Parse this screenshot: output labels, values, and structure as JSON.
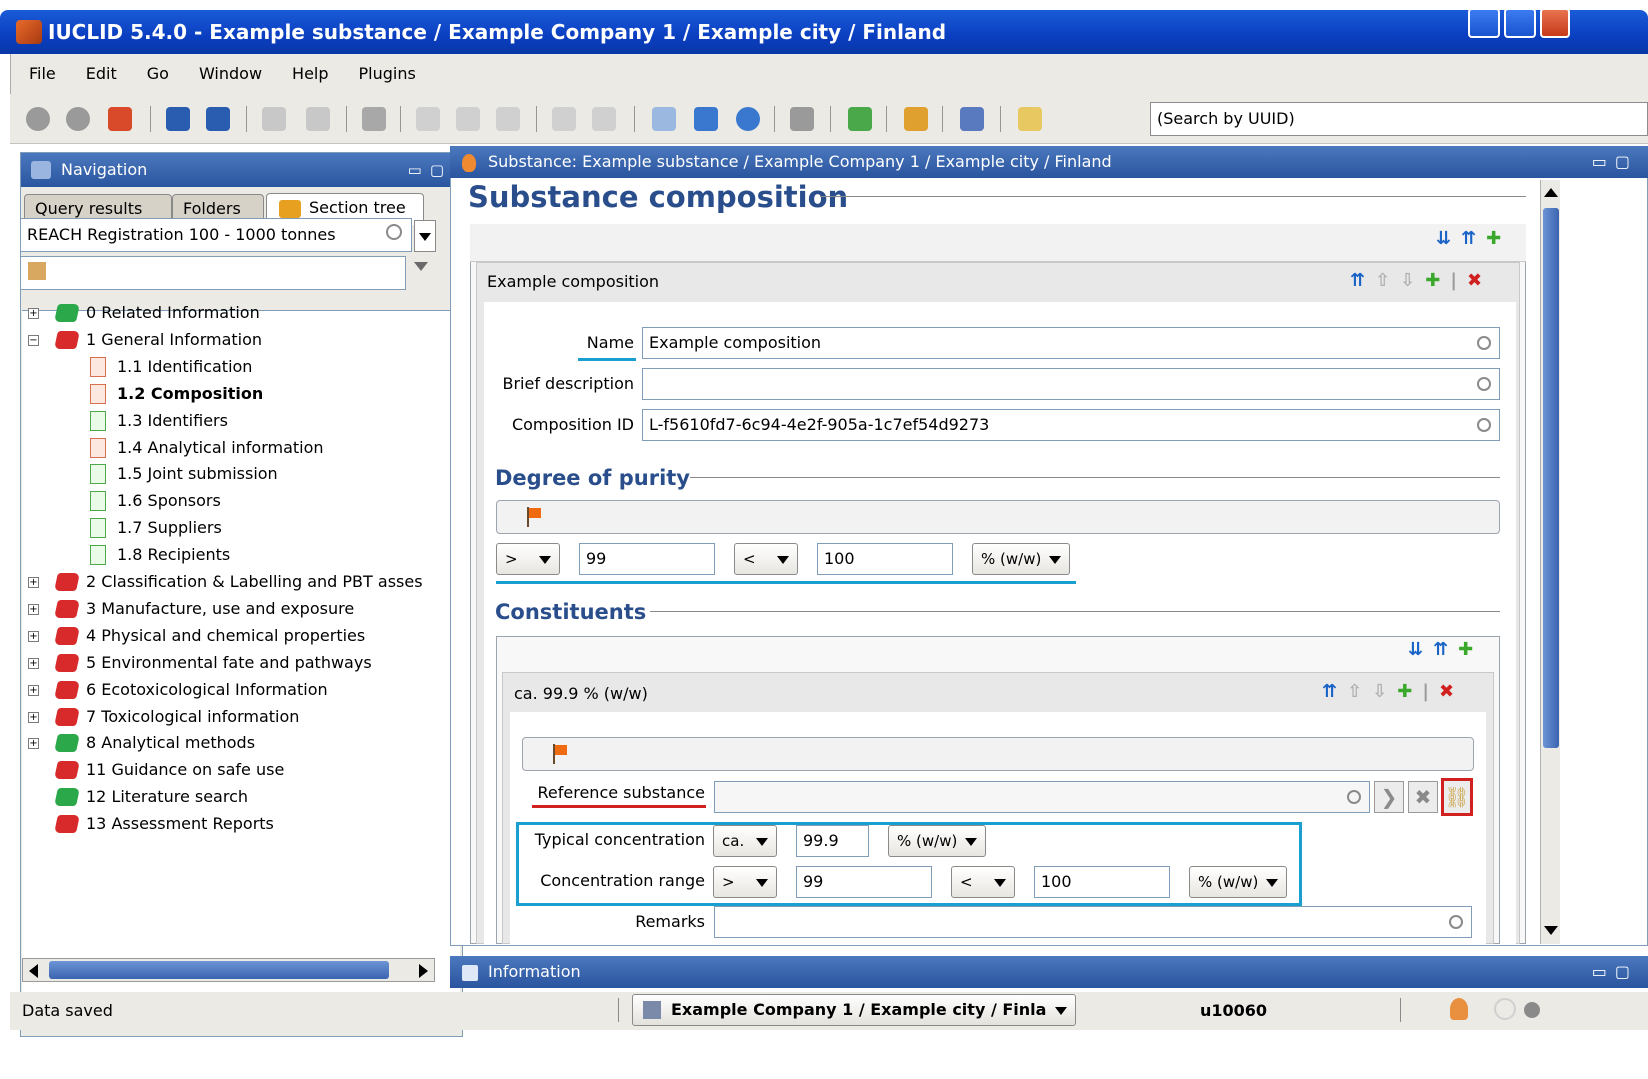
{
  "window": {
    "title": "IUCLID 5.4.0  - Example substance / Example Company 1 / Example city / Finland"
  },
  "menu": [
    "File",
    "Edit",
    "Go",
    "Window",
    "Help",
    "Plugins"
  ],
  "search": {
    "value": "(Search by UUID)"
  },
  "navigation": {
    "title": "Navigation",
    "tabs": [
      "Query results",
      "Folders",
      "Section tree"
    ],
    "template": "REACH Registration 100 - 1000 tonnes",
    "tree": [
      {
        "label": "0 Related Information",
        "book": "green",
        "expand": "+",
        "level": 0
      },
      {
        "label": "1 General Information",
        "book": "red",
        "expand": "-",
        "level": 0
      },
      {
        "label": "1.1 Identification",
        "doc": "pink",
        "level": 1
      },
      {
        "label": "1.2 Composition",
        "doc": "pink",
        "level": 1,
        "bold": true
      },
      {
        "label": "1.3 Identifiers",
        "doc": "green",
        "level": 1
      },
      {
        "label": "1.4 Analytical information",
        "doc": "pink",
        "level": 1
      },
      {
        "label": "1.5 Joint submission",
        "doc": "green",
        "level": 1
      },
      {
        "label": "1.6 Sponsors",
        "doc": "green",
        "level": 1
      },
      {
        "label": "1.7 Suppliers",
        "doc": "green",
        "level": 1
      },
      {
        "label": "1.8 Recipients",
        "doc": "green",
        "level": 1
      },
      {
        "label": "2 Classification & Labelling and PBT asses",
        "book": "red",
        "expand": "+",
        "level": 0
      },
      {
        "label": "3 Manufacture, use and exposure",
        "book": "red",
        "expand": "+",
        "level": 0
      },
      {
        "label": "4 Physical and chemical properties",
        "book": "red",
        "expand": "+",
        "level": 0
      },
      {
        "label": "5 Environmental fate and pathways",
        "book": "red",
        "expand": "+",
        "level": 0
      },
      {
        "label": "6 Ecotoxicological Information",
        "book": "red",
        "expand": "+",
        "level": 0
      },
      {
        "label": "7 Toxicological information",
        "book": "red",
        "expand": "+",
        "level": 0
      },
      {
        "label": "8 Analytical methods",
        "book": "green",
        "expand": "+",
        "level": 0
      },
      {
        "label": "11 Guidance on safe use",
        "book": "red",
        "level": 0
      },
      {
        "label": "12 Literature search",
        "book": "green",
        "level": 0
      },
      {
        "label": "13 Assessment Reports",
        "book": "red",
        "level": 0
      }
    ]
  },
  "editor": {
    "header": "Substance: Example substance / Example Company 1 / Example city / Finland",
    "title": "Substance composition",
    "composition_block": "Example composition",
    "name_label": "Name",
    "name_value": "Example composition",
    "brief_label": "Brief description",
    "brief_value": "",
    "compid_label": "Composition ID",
    "compid_value": "L-f5610fd7-6c94-4e2f-905a-1c7ef54d9273",
    "purity": {
      "title": "Degree of purity",
      "lower_qual": ">",
      "lower": "99",
      "upper_qual": "<",
      "upper": "100",
      "unit": "% (w/w)"
    },
    "constituents": {
      "title": "Constituents",
      "block": "ca. 99.9 % (w/w)",
      "ref_label": "Reference substance",
      "ref_value": "",
      "typical_label": "Typical concentration",
      "typical_qual": "ca.",
      "typical_value": "99.9",
      "typical_unit": "% (w/w)",
      "range_label": "Concentration range",
      "range_lower_qual": ">",
      "range_lower": "99",
      "range_upper_qual": "<",
      "range_upper": "100",
      "range_unit": "% (w/w)",
      "remarks_label": "Remarks"
    }
  },
  "info": {
    "title": "Information"
  },
  "status": {
    "message": "Data saved",
    "company": "Example Company 1 / Example city / Finla",
    "user": "u10060"
  },
  "colors": {
    "titlebar": "#0a3ec0",
    "accent": "#2a4e8c",
    "highlight": "#1aa0d0",
    "underline_red": "#d02020"
  }
}
